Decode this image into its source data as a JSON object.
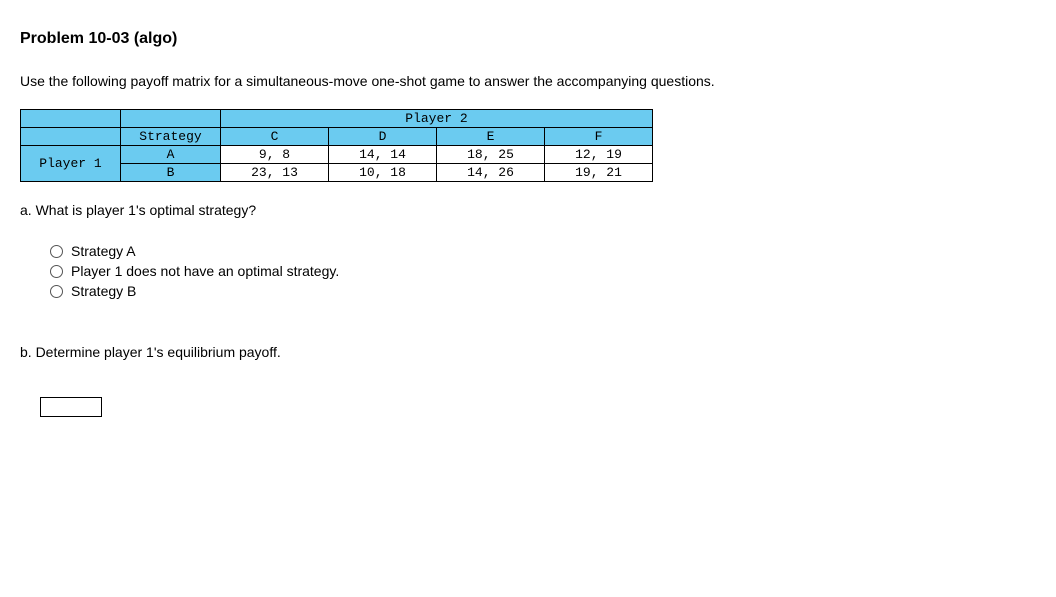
{
  "title": "Problem 10-03 (algo)",
  "instructions": "Use the following payoff matrix for a simultaneous-move one-shot game to answer the accompanying questions.",
  "table": {
    "player2_label": "Player 2",
    "player1_label": "Player 1",
    "strategy_label": "Strategy",
    "col_headers": [
      "C",
      "D",
      "E",
      "F"
    ],
    "row_headers": [
      "A",
      "B"
    ],
    "rows": [
      [
        "9, 8",
        "14, 14",
        "18, 25",
        "12, 19"
      ],
      [
        "23, 13",
        "10, 18",
        "14, 26",
        "19, 21"
      ]
    ]
  },
  "question_a": {
    "text": "a. What is player 1's optimal strategy?",
    "options": [
      "Strategy A",
      "Player 1 does not have an optimal strategy.",
      "Strategy B"
    ]
  },
  "question_b": {
    "text": "b. Determine player 1's equilibrium payoff.",
    "input_value": ""
  }
}
